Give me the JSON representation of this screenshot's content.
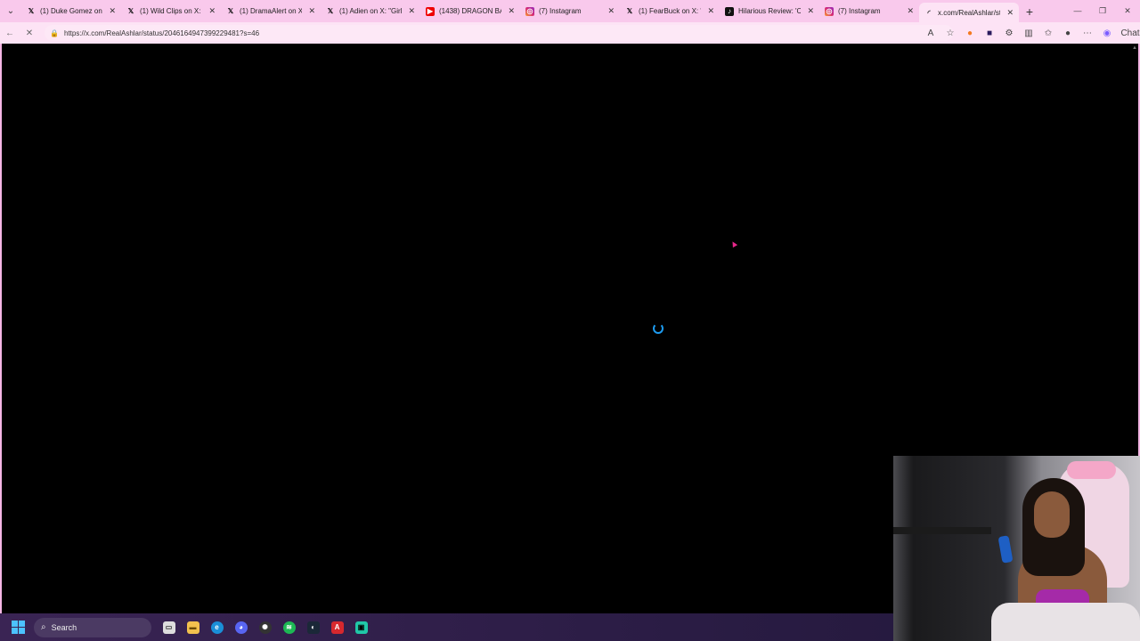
{
  "browser": {
    "tabs": [
      {
        "title": "(1) Duke Gomez on X: ",
        "favicon": "x-icon",
        "active": false
      },
      {
        "title": "(1) Wild Clips on X: \"W",
        "favicon": "x-icon",
        "active": false
      },
      {
        "title": "(1) DramaAlert on X: \"",
        "favicon": "x-icon",
        "active": false
      },
      {
        "title": "(1) Adien on X: \"Girl ge",
        "favicon": "x-icon",
        "active": false
      },
      {
        "title": "(1438) DRAGON BALL",
        "favicon": "youtube-icon",
        "active": false
      },
      {
        "title": "(7) Instagram",
        "favicon": "instagram-icon",
        "active": false
      },
      {
        "title": "(1) FearBuck on X: \"Sh",
        "favicon": "x-icon",
        "active": false
      },
      {
        "title": "Hilarious Review: 'Cra",
        "favicon": "tiktok-icon",
        "active": false
      },
      {
        "title": "(7) Instagram",
        "favicon": "instagram-icon",
        "active": false
      },
      {
        "title": "x.com/RealAshlar/stat",
        "favicon": "loading-icon",
        "active": true
      }
    ],
    "new_tab_symbol": "+",
    "url": "https://x.com/RealAshlar/status/2046164947399229481?s=46",
    "chat_label": "Chat"
  },
  "taskbar": {
    "search_label": "Search"
  },
  "colors": {
    "frame_pink": "#f9c9ec",
    "spinner_blue": "#1d9bf0",
    "page_background": "#000000"
  }
}
